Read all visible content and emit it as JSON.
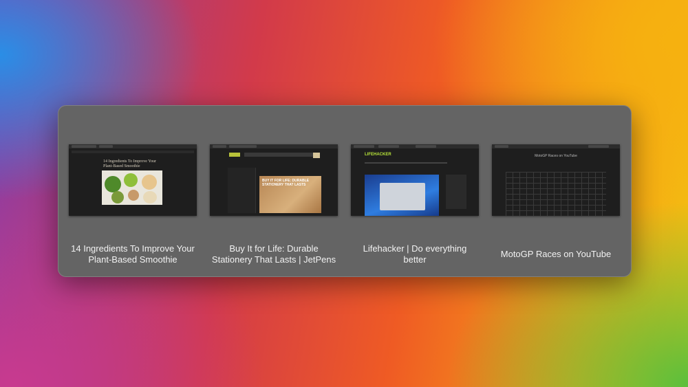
{
  "switcher": {
    "windows": [
      {
        "title": "14 Ingredients To Improve Your Plant-Based Smoothie",
        "thumb_heading": "14 Ingredients To Improve Your Plant-Based Smoothie"
      },
      {
        "title": "Buy It for Life: Durable Stationery That Lasts | JetPens",
        "thumb_heading": "BUY IT FOR LIFE: DURABLE STATIONERY THAT LASTS"
      },
      {
        "title": "Lifehacker | Do everything better",
        "thumb_heading": "LIFEHACKER"
      },
      {
        "title": "MotoGP Races on YouTube",
        "thumb_heading": "MotoGP Races on YouTube"
      }
    ]
  }
}
